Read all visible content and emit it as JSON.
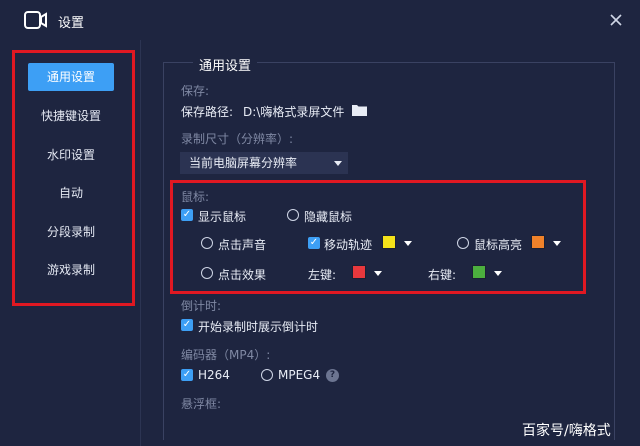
{
  "window": {
    "title": "设置",
    "close_icon": "close-icon"
  },
  "sidebar": {
    "items": [
      {
        "label": "通用设置",
        "active": true
      },
      {
        "label": "快捷键设置"
      },
      {
        "label": "水印设置"
      },
      {
        "label": "自动"
      },
      {
        "label": "分段录制"
      },
      {
        "label": "游戏录制"
      }
    ]
  },
  "main": {
    "section_title": "通用设置",
    "save": {
      "heading": "保存:",
      "path_label": "保存路径:",
      "path_value": "D:\\嗨格式录屏文件"
    },
    "record_size": {
      "heading": "录制尺寸（分辨率）:",
      "selected": "当前电脑屏幕分辨率"
    },
    "mouse": {
      "heading": "鼠标:",
      "show_cursor": "显示鼠标",
      "hide_cursor": "隐藏鼠标",
      "click_sound": "点击声音",
      "move_track": "移动轨迹",
      "highlight": "鼠标高亮",
      "click_effect": "点击效果",
      "left_key": "左键:",
      "right_key": "右键:",
      "colors": {
        "move_track": "#f5e21a",
        "highlight": "#f0822a",
        "left_key": "#e8383d",
        "right_key": "#4caf3e"
      }
    },
    "countdown": {
      "heading": "倒计时:",
      "option": "开始录制时展示倒计时"
    },
    "encoder": {
      "heading": "编码器（MP4）:",
      "h264": "H264",
      "mpeg4": "MPEG4",
      "help": "?"
    },
    "floating": {
      "heading": "悬浮框:"
    }
  },
  "watermark": "百家号/嗨格式",
  "accent": "#3d9ff5",
  "highlight_border": "#e01822"
}
